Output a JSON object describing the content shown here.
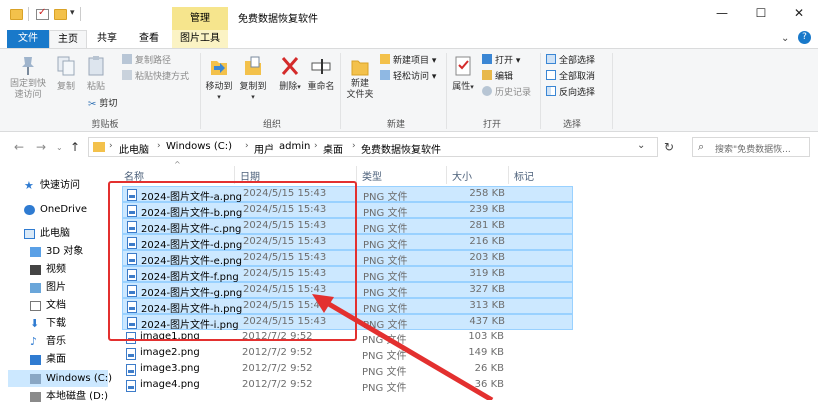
{
  "window": {
    "title": "免费数据恢复软件",
    "manage_tab": "管理",
    "controls": {
      "minimize": "—",
      "maximize": "☐",
      "close": "✕"
    }
  },
  "ribbon_tabs": {
    "file": "文件",
    "home": "主页",
    "share": "共享",
    "view": "查看",
    "picture_tools": "图片工具"
  },
  "ribbon": {
    "pin_quick_access": "固定到快\n速访问",
    "copy": "复制",
    "paste": "粘贴",
    "copy_path": "复制路径",
    "paste_shortcut": "粘贴快捷方式",
    "cut": "剪切",
    "clipboard_group": "剪贴板",
    "move_to": "移动到",
    "copy_to": "复制到",
    "delete": "删除",
    "rename": "重命名",
    "organize_group": "组织",
    "new_folder": "新建\n文件夹",
    "new_item": "新建项目",
    "easy_access": "轻松访问",
    "new_group": "新建",
    "properties": "属性",
    "open": "打开",
    "edit": "编辑",
    "history": "历史记录",
    "open_group": "打开",
    "select_all": "全部选择",
    "select_none": "全部取消",
    "invert_selection": "反向选择",
    "select_group": "选择"
  },
  "address": {
    "crumbs": [
      "此电脑",
      "Windows (C:)",
      "用户",
      "admin",
      "桌面",
      "免费数据恢复软件"
    ],
    "search_placeholder": "搜索\"免费数据恢..."
  },
  "nav": {
    "quick_access": "快速访问",
    "onedrive": "OneDrive",
    "this_pc": "此电脑",
    "objects3d": "3D 对象",
    "videos": "视频",
    "pictures": "图片",
    "documents": "文档",
    "downloads": "下载",
    "music": "音乐",
    "desktop": "桌面",
    "windows_c": "Windows (C:)",
    "local_d": "本地磁盘 (D:)"
  },
  "columns": {
    "name": "名称",
    "date": "日期",
    "type": "类型",
    "size": "大小",
    "tags": "标记"
  },
  "files": [
    {
      "name": "2024-图片文件-a.png",
      "date": "2024/5/15 15:43",
      "type": "PNG 文件",
      "size": "258 KB",
      "selected": true
    },
    {
      "name": "2024-图片文件-b.png",
      "date": "2024/5/15 15:43",
      "type": "PNG 文件",
      "size": "239 KB",
      "selected": true
    },
    {
      "name": "2024-图片文件-c.png",
      "date": "2024/5/15 15:43",
      "type": "PNG 文件",
      "size": "281 KB",
      "selected": true
    },
    {
      "name": "2024-图片文件-d.png",
      "date": "2024/5/15 15:43",
      "type": "PNG 文件",
      "size": "216 KB",
      "selected": true
    },
    {
      "name": "2024-图片文件-e.png",
      "date": "2024/5/15 15:43",
      "type": "PNG 文件",
      "size": "203 KB",
      "selected": true
    },
    {
      "name": "2024-图片文件-f.png",
      "date": "2024/5/15 15:43",
      "type": "PNG 文件",
      "size": "319 KB",
      "selected": true
    },
    {
      "name": "2024-图片文件-g.png",
      "date": "2024/5/15 15:43",
      "type": "PNG 文件",
      "size": "327 KB",
      "selected": true
    },
    {
      "name": "2024-图片文件-h.png",
      "date": "2024/5/15 15:43",
      "type": "PNG 文件",
      "size": "313 KB",
      "selected": true
    },
    {
      "name": "2024-图片文件-i.png",
      "date": "2024/5/15 15:43",
      "type": "PNG 文件",
      "size": "437 KB",
      "selected": true
    },
    {
      "name": "image1.png",
      "date": "2012/7/2 9:52",
      "type": "PNG 文件",
      "size": "103 KB",
      "selected": false
    },
    {
      "name": "image2.png",
      "date": "2012/7/2 9:52",
      "type": "PNG 文件",
      "size": "149 KB",
      "selected": false
    },
    {
      "name": "image3.png",
      "date": "2012/7/2 9:52",
      "type": "PNG 文件",
      "size": "26 KB",
      "selected": false
    },
    {
      "name": "image4.png",
      "date": "2012/7/2 9:52",
      "type": "PNG 文件",
      "size": "36 KB",
      "selected": false
    }
  ],
  "colors": {
    "accent": "#1979ca",
    "selection": "#cce8ff",
    "annotation": "#e3302f"
  }
}
